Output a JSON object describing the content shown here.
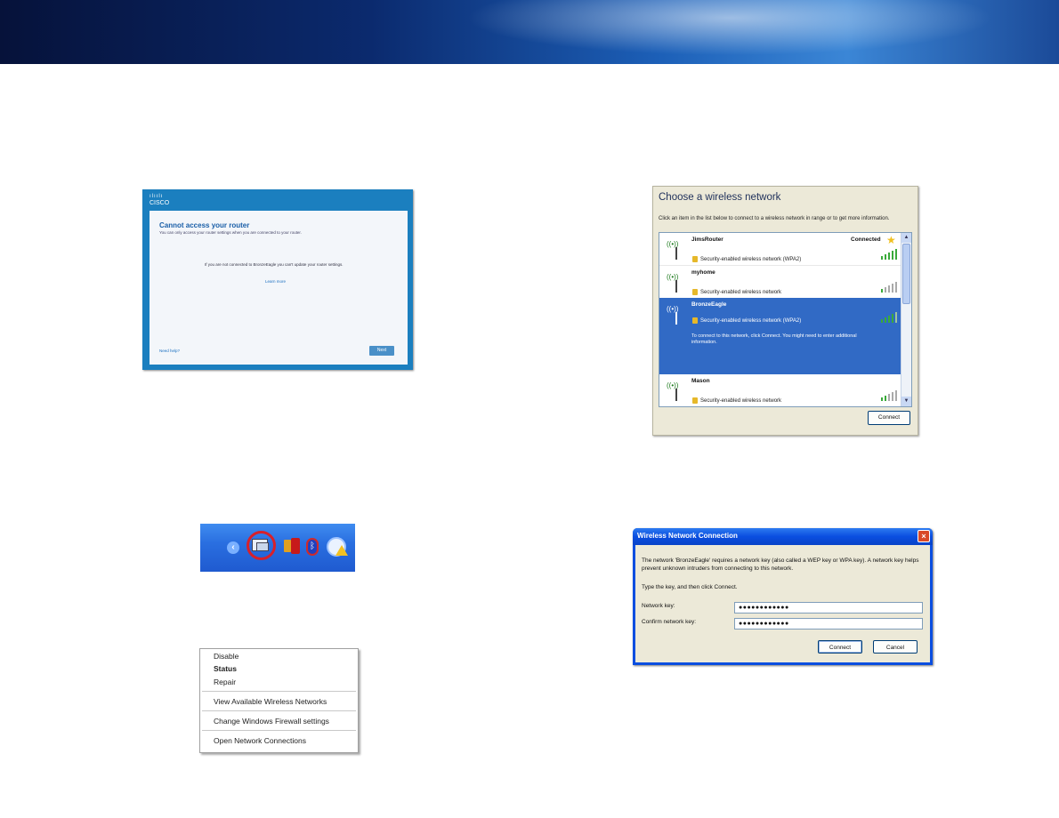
{
  "router": {
    "logo_bars": "ılıılı",
    "logo": "CISCO",
    "title": "Cannot access your router",
    "subtitle": "You can only access your router settings when you are connected to your router.",
    "message": "If you are not connected to BronzeEagle you can't update your router settings.",
    "learn_more": "Learn more",
    "help": "Need help?",
    "next": "Next"
  },
  "taskbar": {
    "chevron": "‹",
    "icons": [
      "chevron-left-icon",
      "wireless-network-icon",
      "speaker-icon",
      "bluetooth-icon",
      "security-warning-icon"
    ]
  },
  "context_menu": {
    "items": [
      "Disable",
      "Status",
      "Repair",
      "View Available Wireless Networks",
      "Change Windows Firewall settings",
      "Open Network Connections"
    ]
  },
  "wireless_list": {
    "title": "Choose a wireless network",
    "description": "Click an item in the list below to connect to a wireless network in range or to get more information.",
    "networks": [
      {
        "name": "JimsRouter",
        "security": "Security-enabled wireless network (WPA2)",
        "status": "Connected",
        "signal": 5
      },
      {
        "name": "myhome",
        "security": "Security-enabled wireless network",
        "status": "",
        "signal": 1
      },
      {
        "name": "BronzeEagle",
        "security": "Security-enabled wireless network (WPA2)",
        "status": "",
        "signal": 4,
        "info": "To connect to this network, click Connect. You might need to enter additional information."
      },
      {
        "name": "Mason",
        "security": "Security-enabled wireless network",
        "status": "",
        "signal": 2
      }
    ],
    "connect_button": "Connect"
  },
  "key_dialog": {
    "title": "Wireless Network Connection",
    "close": "×",
    "message": "The network 'BronzeEagle' requires a network key (also called a WEP key or WPA key). A network key helps prevent unknown intruders from connecting to this network.",
    "instruction": "Type the key, and then click Connect.",
    "key_label": "Network key:",
    "key_value": "●●●●●●●●●●●●",
    "confirm_label": "Confirm network key:",
    "confirm_value": "●●●●●●●●●●●●",
    "connect": "Connect",
    "cancel": "Cancel"
  }
}
